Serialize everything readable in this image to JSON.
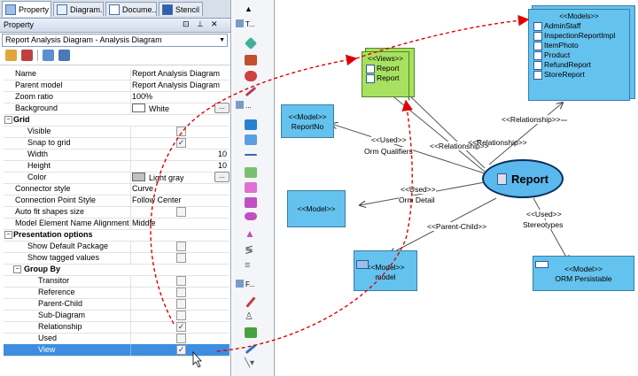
{
  "tabs": [
    "Property",
    "Diagram...",
    "Docume...",
    "Stencil"
  ],
  "panel": {
    "title": "Property",
    "title_buttons": [
      "⊡",
      "⊥",
      "✕"
    ],
    "selector_value": "Report Analysis Diagram - Analysis Diagram"
  },
  "properties": [
    {
      "name": "Name",
      "value": "Report Analysis Diagram"
    },
    {
      "name": "Parent model",
      "value": "Report Analysis Diagram"
    },
    {
      "name": "Zoom ratio",
      "value": "100%"
    },
    {
      "name": "Background",
      "value": "White",
      "swatch": "#ffffff"
    }
  ],
  "grid_section": {
    "title": "Grid",
    "rows": [
      {
        "name": "Visible",
        "checked": false
      },
      {
        "name": "Snap to grid",
        "checked": true
      },
      {
        "name": "Width",
        "value": "10"
      },
      {
        "name": "Height",
        "value": "10"
      },
      {
        "name": "Color",
        "value": "Light gray",
        "swatch": "#c0c0c0"
      }
    ]
  },
  "more_properties": [
    {
      "name": "Connector style",
      "value": "Curve"
    },
    {
      "name": "Connection Point Style",
      "value": "Follow Center"
    },
    {
      "name": "Auto fit shapes size",
      "checked": false
    },
    {
      "name": "Model Element Name Alignment",
      "value": "Middle"
    }
  ],
  "presentation": {
    "title": "Presentation options",
    "rows": [
      {
        "name": "Show Default Package",
        "checked": false
      },
      {
        "name": "Show tagged values",
        "checked": false
      }
    ],
    "group_by": {
      "title": "Group By",
      "rows": [
        {
          "name": "Transitor",
          "checked": false
        },
        {
          "name": "Reference",
          "checked": false
        },
        {
          "name": "Parent-Child",
          "checked": false
        },
        {
          "name": "Sub-Diagram",
          "checked": false
        },
        {
          "name": "Relationship",
          "checked": true
        },
        {
          "name": "Used",
          "checked": false
        },
        {
          "name": "View",
          "checked": true,
          "selected": true
        }
      ]
    }
  },
  "palette": {
    "labels": [
      "T...",
      "...",
      "F..."
    ]
  },
  "diagram": {
    "views": {
      "title": "<<Views>>",
      "items": [
        "Report",
        "Report"
      ]
    },
    "models": {
      "title": "<<Models>>",
      "items": [
        "AdminStaff",
        "InspectionReportImpl",
        "ItemPhoto",
        "Product",
        "RefundReport",
        "StoreReport"
      ]
    },
    "report_no": {
      "stereo": "<<Model>>",
      "name": "ReportNo"
    },
    "model_left": {
      "stereo": "<<Model>>"
    },
    "model_bottom": {
      "stereo": "<<Model>>",
      "name": "model"
    },
    "orm": {
      "stereo": "<<Model>>",
      "name": "ORM Persistable"
    },
    "report": "Report",
    "labels": {
      "used_qualifiers": "<<Used>>",
      "orm_qualifiers": "Orm Qualifiers",
      "relationship1": "<<Relationship>>",
      "relationship2": "<<Relationship>>",
      "relationship_top": "<<Relationship>>",
      "used_detail": "<<Used>>",
      "orm_detail": "Orm Detail",
      "parent_child": "<<Parent-Child>>",
      "used_stereo": "<<Used>>",
      "stereotypes": "Stereotypes"
    }
  },
  "colors": {
    "model_fill": "#64c2ee",
    "report_fill": "#5ab8ec",
    "views_fill": "#a8e060",
    "arrow_red": "#e00000",
    "selection": "#3d8ee0"
  }
}
